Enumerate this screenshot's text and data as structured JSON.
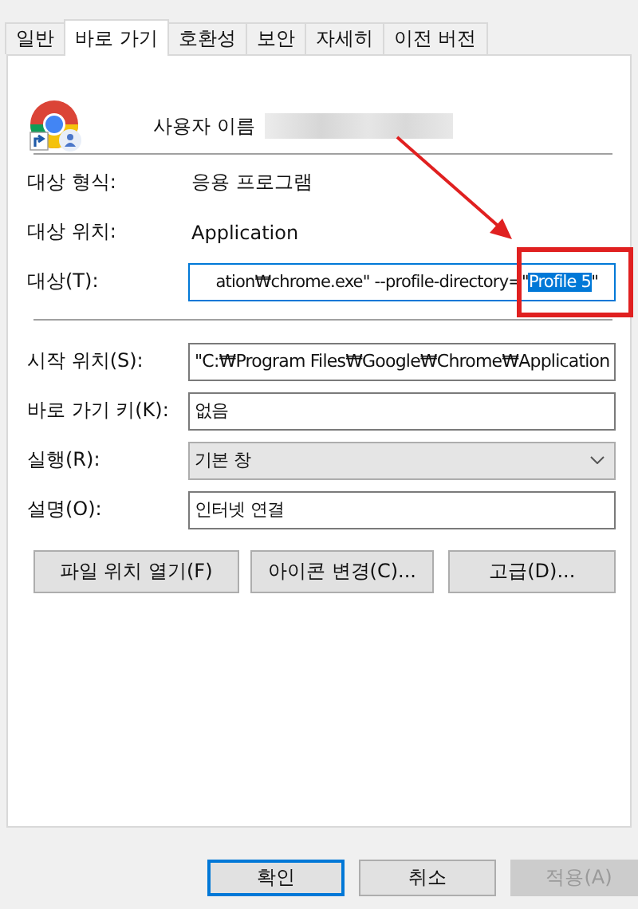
{
  "tabs": [
    {
      "label": "일반",
      "selected": false
    },
    {
      "label": "바로 가기",
      "selected": true
    },
    {
      "label": "호환성",
      "selected": false
    },
    {
      "label": "보안",
      "selected": false
    },
    {
      "label": "자세히",
      "selected": false
    },
    {
      "label": "이전 버전",
      "selected": false
    }
  ],
  "header": {
    "name_label": "사용자 이름"
  },
  "info": [
    {
      "kind": "static",
      "label": "대상 형식:",
      "value": "응용 프로그램"
    },
    {
      "kind": "static",
      "label": "대상 위치:",
      "value": "Application"
    },
    {
      "kind": "target",
      "label": "대상(T):",
      "value": "ation₩chrome.exe\"  --profile-directory=\"",
      "selection": "Profile 5",
      "after": "\""
    }
  ],
  "settings": [
    {
      "kind": "text",
      "label": "시작 위치(S):",
      "value": "\"C:₩Program Files₩Google₩Chrome₩Application"
    },
    {
      "kind": "text",
      "label": "바로 가기 키(K):",
      "value": "없음"
    },
    {
      "kind": "select",
      "label": "실행(R):",
      "value": "기본 창"
    },
    {
      "kind": "text",
      "label": "설명(O):",
      "value": "인터넷 연결"
    }
  ],
  "buttons": [
    "파일 위치 열기(F)",
    "아이콘 변경(C)...",
    "고급(D)..."
  ],
  "dialog_buttons": [
    {
      "label": "확인",
      "default": true,
      "disabled": false
    },
    {
      "label": "취소",
      "default": false,
      "disabled": false
    },
    {
      "label": "적용(A)",
      "default": false,
      "disabled": true
    }
  ]
}
